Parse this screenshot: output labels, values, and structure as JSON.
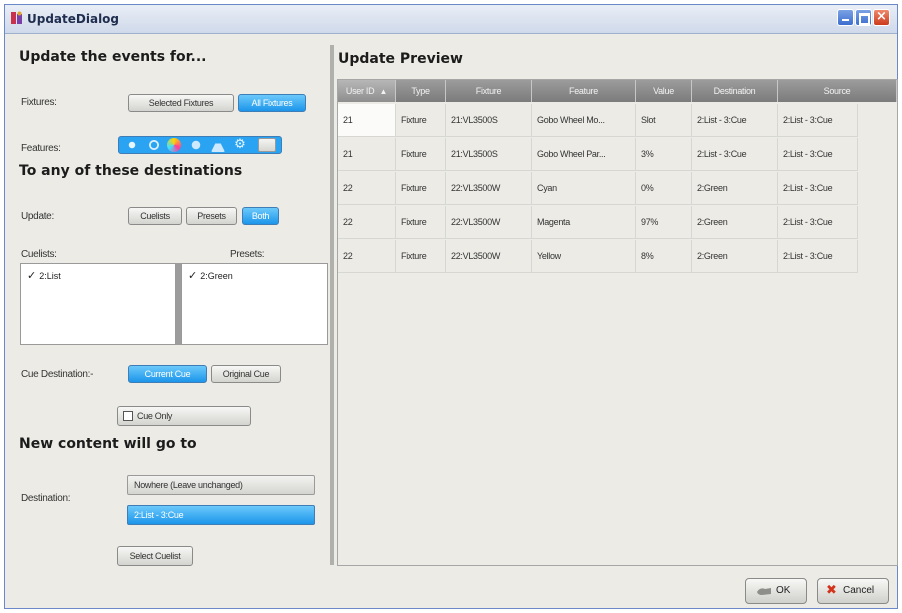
{
  "window": {
    "title": "UpdateDialog",
    "close_glyph": "×"
  },
  "left": {
    "heading_events": "Update the events for...",
    "fixtures_label": "Fixtures:",
    "fixtures_options": [
      "Selected Fixtures",
      "All Fixtures"
    ],
    "fixtures_selected": "All Fixtures",
    "features_label": "Features:",
    "feature_icons": [
      "intensity-icon",
      "position-icon",
      "color-icon",
      "beam-icon",
      "effect-icon",
      "settings-icon",
      "blank-icon"
    ],
    "heading_destinations": "To any of these destinations",
    "update_label": "Update:",
    "update_options": [
      "Cuelists",
      "Presets",
      "Both"
    ],
    "update_selected": "Both",
    "cuelists_label": "Cuelists:",
    "presets_label": "Presets:",
    "cuelist_item": "2:List",
    "preset_item": "2:Green",
    "check_glyph": "✓",
    "cue_destination_label": "Cue Destination:-",
    "cue_destination_options": [
      "Current Cue",
      "Original Cue"
    ],
    "cue_destination_selected": "Current Cue",
    "cue_only_label": "Cue Only",
    "heading_new_content": "New content will go to",
    "destination_label": "Destination:",
    "destination_options": [
      "Nowhere (Leave unchanged)",
      "2:List - 3:Cue"
    ],
    "destination_selected": "2:List - 3:Cue",
    "select_cuelist_label": "Select Cuelist"
  },
  "preview": {
    "heading": "Update Preview",
    "columns": [
      "User ID",
      "Type",
      "Fixture",
      "Feature",
      "Value",
      "Destination",
      "Source"
    ],
    "sort_glyph": "▲",
    "rows": [
      [
        "21",
        "Fixture",
        "21:VL3500S",
        "Gobo Wheel Mo...",
        "Slot",
        "2:List - 3:Cue",
        "2:List - 3:Cue"
      ],
      [
        "21",
        "Fixture",
        "21:VL3500S",
        "Gobo Wheel Par...",
        "3%",
        "2:List - 3:Cue",
        "2:List - 3:Cue"
      ],
      [
        "22",
        "Fixture",
        "22:VL3500W",
        "Cyan",
        "0%",
        "2:Green",
        "2:List - 3:Cue"
      ],
      [
        "22",
        "Fixture",
        "22:VL3500W",
        "Magenta",
        "97%",
        "2:Green",
        "2:List - 3:Cue"
      ],
      [
        "22",
        "Fixture",
        "22:VL3500W",
        "Yellow",
        "8%",
        "2:Green",
        "2:List - 3:Cue"
      ]
    ]
  },
  "footer": {
    "ok_label": "OK",
    "cancel_label": "Cancel",
    "cancel_glyph": "✖"
  },
  "colors": {
    "active_button": "#1c95ea",
    "header_gray": "#8c8c8c",
    "window_bg": "#ecebe6"
  }
}
